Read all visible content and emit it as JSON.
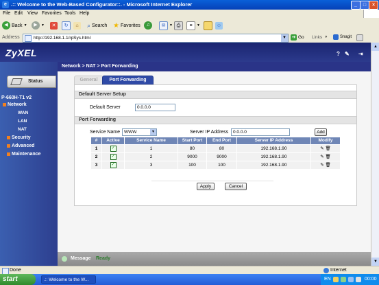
{
  "window": {
    "title": ".:: Welcome to the Web-Based Configurator::. - Microsoft Internet Explorer"
  },
  "menu": [
    "File",
    "Edit",
    "View",
    "Favorites",
    "Tools",
    "Help"
  ],
  "toolbar": {
    "back": "Back",
    "search": "Search",
    "favorites": "Favorites"
  },
  "address": {
    "label": "Address",
    "url": "http://192.168.1.1/rpSys.html",
    "go": "Go",
    "links": "Links",
    "snagit": "Snagit"
  },
  "router": {
    "logo": "ZyXEL",
    "breadcrumb": "Network > NAT > Port Forwarding",
    "status_button": "Status",
    "device": "P-660H-T1 v2",
    "nav": {
      "network": "Network",
      "wan": "WAN",
      "lan": "LAN",
      "nat": "NAT",
      "security": "Security",
      "advanced": "Advanced",
      "maintenance": "Maintenance"
    },
    "tabs": {
      "general": "General",
      "port_forwarding": "Port Forwarding"
    },
    "default_server": {
      "section": "Default Server Setup",
      "label": "Default Server",
      "value": "0.0.0.0"
    },
    "port_forwarding": {
      "section": "Port Forwarding",
      "service_name_label": "Service Name",
      "service_name_value": "WWW",
      "server_ip_label": "Server IP Address",
      "server_ip_value": "0.0.0.0",
      "add": "Add",
      "columns": [
        "#",
        "Active",
        "Service Name",
        "Start Port",
        "End Port",
        "Server IP Address",
        "Modify"
      ],
      "rows": [
        {
          "num": "1",
          "active": true,
          "name": "1",
          "start": "80",
          "end": "80",
          "ip": "192.168.1.90"
        },
        {
          "num": "2",
          "active": true,
          "name": "2",
          "start": "9000",
          "end": "9000",
          "ip": "192.168.1.90"
        },
        {
          "num": "3",
          "active": true,
          "name": "3",
          "start": "100",
          "end": "100",
          "ip": "192.168.1.90"
        }
      ]
    },
    "buttons": {
      "apply": "Apply",
      "cancel": "Cancel"
    },
    "message": {
      "label": "Message",
      "value": "Ready"
    }
  },
  "statusbar": {
    "left": "Done",
    "zone": "Internet"
  },
  "taskbar": {
    "start": "start",
    "task": ".:: Welcome to the W...",
    "lang": "EN",
    "clock": "00:00"
  }
}
